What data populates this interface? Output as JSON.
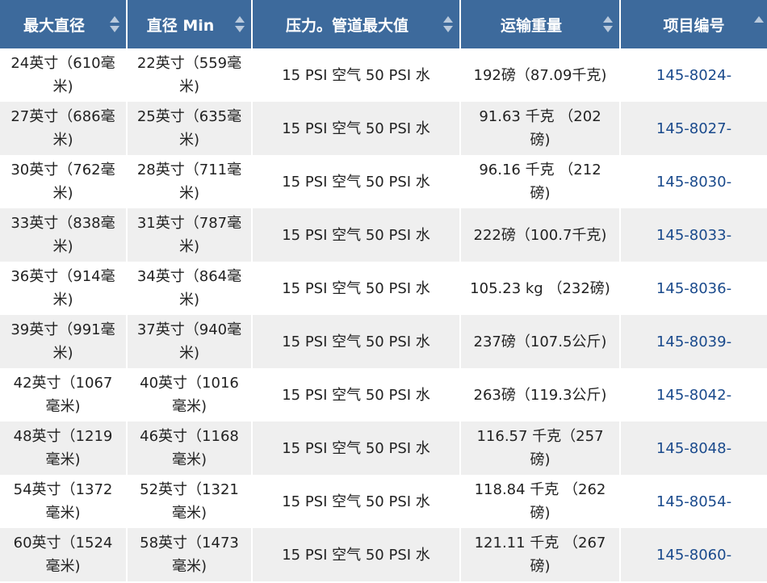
{
  "headers": {
    "max_diameter": "最大直径",
    "min_diameter": "直径 Min",
    "pressure": "压力。管道最大值",
    "shipping_weight": "运输重量",
    "item_number": "项目编号"
  },
  "rows": [
    {
      "max_diameter": "24英寸（610毫米)",
      "min_diameter": "22英寸（559毫米)",
      "pressure": "15 PSI 空气 50 PSI 水",
      "shipping_weight": "192磅（87.09千克)",
      "item_number": "145-8024-"
    },
    {
      "max_diameter": "27英寸（686毫米)",
      "min_diameter": "25英寸（635毫米)",
      "pressure": "15 PSI 空气 50 PSI 水",
      "shipping_weight": "91.63 千克 （202 磅)",
      "item_number": "145-8027-"
    },
    {
      "max_diameter": "30英寸（762毫米)",
      "min_diameter": "28英寸（711毫米)",
      "pressure": "15 PSI 空气 50 PSI 水",
      "shipping_weight": "96.16 千克 （212 磅)",
      "item_number": "145-8030-"
    },
    {
      "max_diameter": "33英寸（838毫米)",
      "min_diameter": "31英寸（787毫米)",
      "pressure": "15 PSI 空气 50 PSI 水",
      "shipping_weight": "222磅（100.7千克)",
      "item_number": "145-8033-"
    },
    {
      "max_diameter": "36英寸（914毫米)",
      "min_diameter": "34英寸（864毫米)",
      "pressure": "15 PSI 空气 50 PSI 水",
      "shipping_weight": "105.23 kg （232磅)",
      "item_number": "145-8036-"
    },
    {
      "max_diameter": "39英寸（991毫米)",
      "min_diameter": "37英寸（940毫米)",
      "pressure": "15 PSI 空气 50 PSI 水",
      "shipping_weight": "237磅（107.5公斤)",
      "item_number": "145-8039-"
    },
    {
      "max_diameter": "42英寸（1067毫米)",
      "min_diameter": "40英寸（1016毫米)",
      "pressure": "15 PSI 空气 50 PSI 水",
      "shipping_weight": "263磅（119.3公斤)",
      "item_number": "145-8042-"
    },
    {
      "max_diameter": "48英寸（1219毫米)",
      "min_diameter": "46英寸（1168毫米)",
      "pressure": "15 PSI 空气 50 PSI 水",
      "shipping_weight": "116.57 千克（257 磅)",
      "item_number": "145-8048-"
    },
    {
      "max_diameter": "54英寸（1372毫米)",
      "min_diameter": "52英寸（1321毫米)",
      "pressure": "15 PSI 空气 50 PSI 水",
      "shipping_weight": "118.84 千克 （262 磅)",
      "item_number": "145-8054-"
    },
    {
      "max_diameter": "60英寸（1524毫米)",
      "min_diameter": "58英寸（1473毫米)",
      "pressure": "15 PSI 空气 50 PSI 水",
      "shipping_weight": "121.11 千克 （267 磅)",
      "item_number": "145-8060-"
    }
  ],
  "colors": {
    "header_bg": "#3d6a9c",
    "header_text": "#ffffff",
    "row_alt_bg": "#efefef",
    "link": "#1a4a8c"
  },
  "icons": {
    "sort": "sort-up-down-icon",
    "sort_asc": "sort-asc-icon"
  }
}
